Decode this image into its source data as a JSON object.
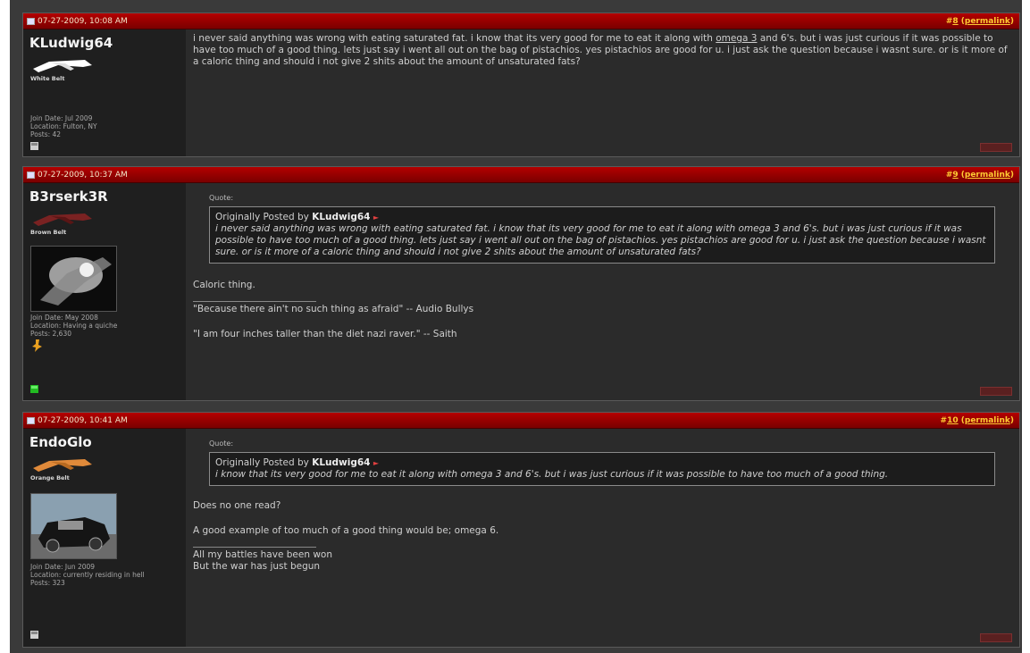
{
  "colors": {
    "header_red": "#b40000",
    "username": "#f4f4f4",
    "postnum": "#ffcc33"
  },
  "posts": [
    {
      "date": "07-27-2009, 10:08 AM",
      "number": "8",
      "permalink": "permalink",
      "username": "KLudwig64",
      "rank": "White Belt",
      "belt_color": "#ffffff",
      "join": "Join Date: Jul 2009",
      "location": "Location: Fulton, NY",
      "posts": "Posts: 42",
      "body_pre": "i never said anything was wrong with eating saturated fat. i know that its very good for me to eat it along with ",
      "body_link": "omega 3",
      "body_post": " and 6's. but i was just curious if it was possible to have too much of a good thing. lets just say i went all out on the bag of pistachios. yes pistachios are good for u. i just ask the question because i wasnt sure. or is it more of a caloric thing and should i not give 2 shits about the amount of unsaturated fats?",
      "status": "offline-icon"
    },
    {
      "date": "07-27-2009, 10:37 AM",
      "number": "9",
      "permalink": "permalink",
      "username": "B3rserk3R",
      "rank": "Brown Belt",
      "belt_color": "#7a2222",
      "join": "Join Date: May 2008",
      "location": "Location: Having a quiche",
      "posts": "Posts: 2,630",
      "quote_label": "Quote:",
      "quote_prefix": "Originally Posted by",
      "quote_author": "KLudwig64",
      "quote_text": "i never said anything was wrong with eating saturated fat. i know that its very good for me to eat it along with omega 3 and 6's. but i was just curious if it was possible to have too much of a good thing. lets just say i went all out on the bag of pistachios. yes pistachios are good for u. i just ask the question because i wasnt sure. or is it more of a caloric thing and should i not give 2 shits about the amount of unsaturated fats?",
      "reply": "Caloric thing.",
      "sig1": "\"Because there ain't no such thing as afraid\" -- Audio Bullys",
      "sig2": "\"I am four inches taller than the diet nazi raver.\" -- Saith",
      "status": "online-icon"
    },
    {
      "date": "07-27-2009, 10:41 AM",
      "number": "10",
      "permalink": "permalink",
      "username": "EndoGlo",
      "rank": "Orange Belt",
      "belt_color": "#e08a3a",
      "join": "Join Date: Jun 2009",
      "location": "Location: currently residing in hell",
      "posts": "Posts: 323",
      "quote_label": "Quote:",
      "quote_prefix": "Originally Posted by",
      "quote_author": "KLudwig64",
      "quote_text": "i know that its very good for me to eat it along with omega 3 and 6's. but i was just curious if it was possible to have too much of a good thing.",
      "reply1": "Does no one read?",
      "reply2": "A good example of too much of a good thing would be; omega 6.",
      "sig1": "All my battles have been won",
      "sig2": "But the war has just begun",
      "status": "offline-icon"
    }
  ]
}
